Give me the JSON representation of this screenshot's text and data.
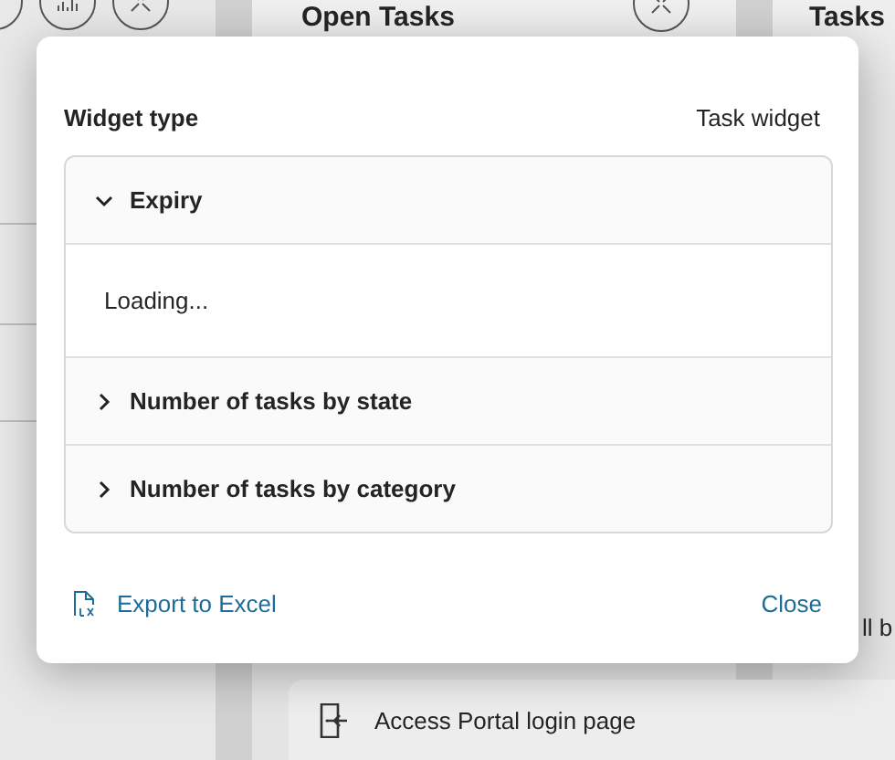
{
  "background": {
    "card_title": "Open Tasks",
    "side_title": "Tasks",
    "partial_text": "ll b",
    "action_label": "Access Portal login page"
  },
  "dialog": {
    "label": "Widget type",
    "value": "Task widget",
    "sections": [
      {
        "title": "Expiry",
        "expanded": true,
        "body": "Loading..."
      },
      {
        "title": "Number of tasks by state",
        "expanded": false
      },
      {
        "title": "Number of tasks by category",
        "expanded": false
      }
    ],
    "export_label": "Export to Excel",
    "close_label": "Close"
  }
}
